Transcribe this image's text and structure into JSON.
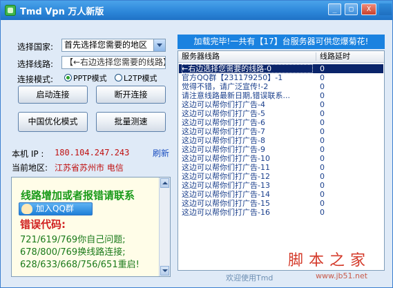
{
  "window": {
    "title": "Tmd Vpn 万人新版",
    "buttons": {
      "min": "_",
      "max": "□",
      "close": "X"
    }
  },
  "form": {
    "country_label": "选择国家:",
    "country_value": "首先选择您需要的地区",
    "line_label": "选择线路:",
    "line_value": "【←右边选择您需要的线路】",
    "mode_label": "连接模式:",
    "mode_pptp": "PPTP模式",
    "mode_l2tp": "L2TP模式"
  },
  "buttons": {
    "connect": "启动连接",
    "disconnect": "断开连接",
    "china_optimize": "中国优化模式",
    "batch_test": "批量测速"
  },
  "info": {
    "ip_label": "本机 IP :",
    "ip_value": "180.104.247.243",
    "refresh": "刷新",
    "region_label": "当前地区:",
    "region_value": "江苏省苏州市 电信"
  },
  "notice": {
    "head": "线路增加或者报错请联系",
    "qq_button": "加入QQ群",
    "error_title": "错误代码:",
    "lines": [
      "721/619/769你自己问题;",
      "678/800/769换线路连接;",
      "628/633/668/756/651重启!"
    ]
  },
  "banner": "加载完毕!一共有【17】台服务器可供您爆菊花!",
  "server_list": {
    "col_name": "服务器线路",
    "col_latency": "线路延时",
    "rows": [
      {
        "name": "←右边选择您需要的线路-0",
        "latency": "0",
        "selected": true
      },
      {
        "name": "官方QQ群【231179250】-1",
        "latency": "0"
      },
      {
        "name": "觉得不错，请广泛宣传!-2",
        "latency": "0"
      },
      {
        "name": "请注意线路最新日期,错误联系...",
        "latency": "0"
      },
      {
        "name": "这边可以帮你们打广告-4",
        "latency": "0"
      },
      {
        "name": "这边可以帮你们打广告-5",
        "latency": "0"
      },
      {
        "name": "这边可以帮你们打广告-6",
        "latency": "0"
      },
      {
        "name": "这边可以帮你们打广告-7",
        "latency": "0"
      },
      {
        "name": "这边可以帮你们打广告-8",
        "latency": "0"
      },
      {
        "name": "这边可以帮你们打广告-9",
        "latency": "0"
      },
      {
        "name": "这边可以帮你们打广告-10",
        "latency": "0"
      },
      {
        "name": "这边可以帮你们打广告-11",
        "latency": "0"
      },
      {
        "name": "这边可以帮你们打广告-12",
        "latency": "0"
      },
      {
        "name": "这边可以帮你们打广告-13",
        "latency": "0"
      },
      {
        "name": "这边可以帮你们打广告-14",
        "latency": "0"
      },
      {
        "name": "这边可以帮你们打广告-15",
        "latency": "0"
      },
      {
        "name": "这边可以帮你们打广告-16",
        "latency": "0"
      }
    ]
  },
  "footer": "欢迎使用Tmd",
  "watermark": {
    "text": "脚本之家",
    "url": "www.jb51.net"
  }
}
